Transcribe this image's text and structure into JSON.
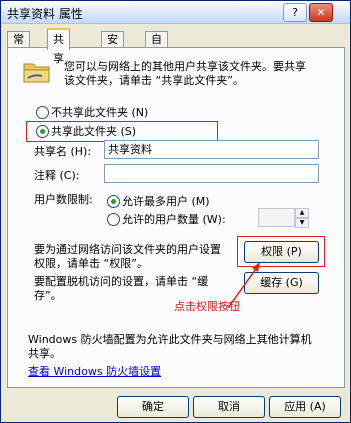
{
  "window": {
    "title": "共享资料 属性",
    "help_btn": "?",
    "close_btn": "✕"
  },
  "tabs": [
    {
      "label": "常规"
    },
    {
      "label": "共享"
    },
    {
      "label": "安全"
    },
    {
      "label": "自定义"
    }
  ],
  "intro": {
    "line1": "您可以与网络上的其他用户共享该文件夹。要共享",
    "line2": "该文件夹，请单击 “共享此文件夹”。"
  },
  "sharing": {
    "no_share_label": "不共享此文件夹 (N)",
    "share_label": "共享此文件夹 (S)",
    "share_name_label": "共享名 (H):",
    "share_name_value": "共享资料",
    "comment_label": "注释 (C):",
    "comment_value": "",
    "user_limit_label": "用户数限制:",
    "max_users_label": "允许最多用户 (M)",
    "allowed_users_label": "允许的用户数量 (W):"
  },
  "permissions": {
    "desc1": "要为通过网络访问该文件夹的用户设置",
    "desc2": "权限，请单击 “权限”。",
    "button": "权限 (P)"
  },
  "caching": {
    "desc1": "要配置脱机访问的设置，请单击 “缓",
    "desc2": "存”。",
    "button": "缓存 (G)"
  },
  "annotation": {
    "text": "点击权限按钮"
  },
  "firewall": {
    "desc1": "Windows 防火墙配置为允许此文件夹与网络上其他计算机",
    "desc2": "共享。",
    "link": "查看 Windows 防火墙设置"
  },
  "footer": {
    "ok": "确定",
    "cancel": "取消",
    "apply": "应用 (A)"
  },
  "colors": {
    "annotation": "#e02020",
    "title_bg": "#d6e6fb",
    "panel_bg": "#fcfcfe",
    "dialog_bg": "#ece9d8"
  }
}
